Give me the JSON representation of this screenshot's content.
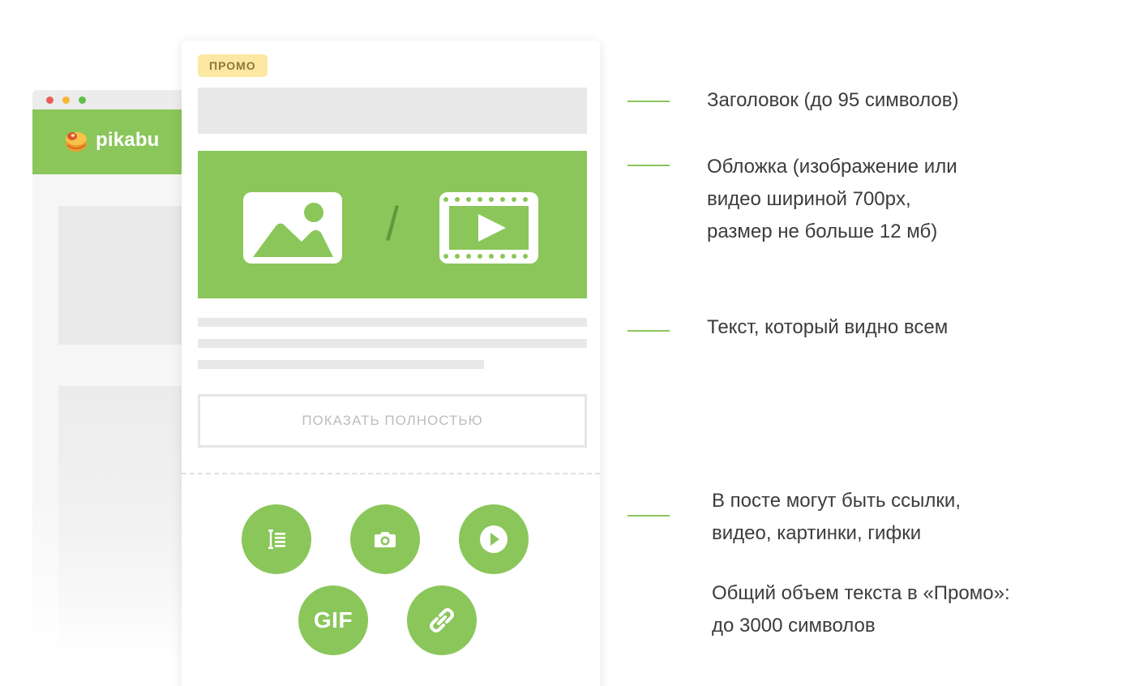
{
  "colors": {
    "green": "#8bc65b",
    "badge_bg": "#fde8a3",
    "placeholder": "#e8e8e8"
  },
  "browser": {
    "logo_text": "pikabu",
    "logo_icon": "pikabu-logo-icon"
  },
  "card": {
    "badge_label": "ПРОМО",
    "cover_separator": "/",
    "cover_icons": [
      "image-icon",
      "video-icon"
    ],
    "show_button_label": "ПОКАЗАТЬ ПОЛНОСТЬЮ",
    "content_buttons": [
      {
        "icon": "text-block-icon"
      },
      {
        "icon": "camera-icon"
      },
      {
        "icon": "play-icon"
      },
      {
        "icon": "gif-icon",
        "label": "GIF"
      },
      {
        "icon": "link-icon"
      }
    ]
  },
  "annotations": {
    "title": [
      "Заголовок (до 95 символов)"
    ],
    "cover": [
      "Обложка (изображение или",
      "видео шириной 700px,",
      "размер не больше 12 мб)"
    ],
    "text": [
      "Текст, который видно всем"
    ],
    "content": [
      "В посте могут быть ссылки,",
      "видео, картинки, гифки"
    ],
    "limit": [
      "Общий объем текста в «Промо»:",
      "до 3000 символов"
    ]
  }
}
